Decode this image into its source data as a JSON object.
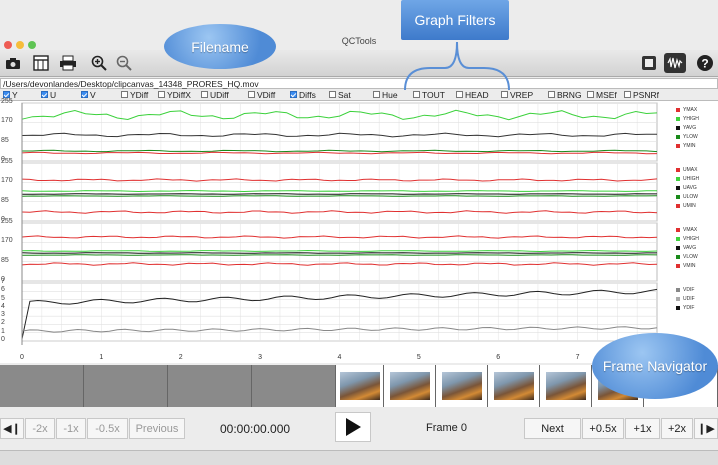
{
  "window": {
    "title": "QCTools"
  },
  "toolbar": {
    "left_icons": [
      "camera-icon",
      "export-icon",
      "print-icon",
      "zoom-in-icon",
      "zoom-out-icon"
    ],
    "right_icons": [
      "windows-icon",
      "waveform-icon",
      "help-icon"
    ]
  },
  "file": {
    "path": "/Users/devonlandes/Desktop/clipcanvas_14348_PRORES_HQ.mov"
  },
  "filters": [
    {
      "label": "Y",
      "checked": true
    },
    {
      "label": "U",
      "checked": true
    },
    {
      "label": "V",
      "checked": true
    },
    {
      "label": "YDiff",
      "checked": false
    },
    {
      "label": "YDiffX",
      "checked": false
    },
    {
      "label": "UDiff",
      "checked": false
    },
    {
      "label": "VDiff",
      "checked": false
    },
    {
      "label": "Diffs",
      "checked": true
    },
    {
      "label": "Sat",
      "checked": false
    },
    {
      "label": "Hue",
      "checked": false
    },
    {
      "label": "TOUT",
      "checked": false
    },
    {
      "label": "HEAD",
      "checked": false
    },
    {
      "label": "VREP",
      "checked": false
    },
    {
      "label": "BRNG",
      "checked": false
    },
    {
      "label": "MSEf",
      "checked": false
    },
    {
      "label": "PSNRf",
      "checked": false
    }
  ],
  "plots": [
    {
      "yticks": [
        "255",
        "170",
        "85",
        "0"
      ],
      "legend": [
        {
          "name": "YMAX",
          "color": "#e03030"
        },
        {
          "name": "YHIGH",
          "color": "#3bd13b"
        },
        {
          "name": "YAVG",
          "color": "#111111"
        },
        {
          "name": "YLOW",
          "color": "#1a8a1a"
        },
        {
          "name": "YMIN",
          "color": "#e03030"
        }
      ]
    },
    {
      "yticks": [
        "255",
        "170",
        "85",
        "0"
      ],
      "legend": [
        {
          "name": "UMAX",
          "color": "#e03030"
        },
        {
          "name": "UHIGH",
          "color": "#3bd13b"
        },
        {
          "name": "UAVG",
          "color": "#111111"
        },
        {
          "name": "ULOW",
          "color": "#1a8a1a"
        },
        {
          "name": "UMIN",
          "color": "#e03030"
        }
      ]
    },
    {
      "yticks": [
        "255",
        "170",
        "85",
        "0"
      ],
      "legend": [
        {
          "name": "VMAX",
          "color": "#e03030"
        },
        {
          "name": "VHIGH",
          "color": "#3bd13b"
        },
        {
          "name": "VAVG",
          "color": "#111111"
        },
        {
          "name": "VLOW",
          "color": "#1a8a1a"
        },
        {
          "name": "VMIN",
          "color": "#e03030"
        }
      ]
    },
    {
      "yticks": [
        "7",
        "6",
        "5",
        "4",
        "3",
        "2",
        "1",
        "0"
      ],
      "legend": [
        {
          "name": "VDIF",
          "color": "#888888"
        },
        {
          "name": "UDIF",
          "color": "#aaaaaa"
        },
        {
          "name": "YDIF",
          "color": "#111111"
        }
      ]
    }
  ],
  "xticks": [
    "0",
    "1",
    "2",
    "3",
    "4",
    "5",
    "6",
    "7"
  ],
  "navigator": {
    "back_label": "◀❙",
    "minus2": "-2x",
    "minus1": "-1x",
    "minus05": "-0.5x",
    "previous": "Previous",
    "timecode": "00:00:00.000",
    "frame": "Frame 0",
    "next": "Next",
    "plus05": "+0.5x",
    "plus1": "+1x",
    "plus2": "+2x",
    "forward_label": "❙▶"
  },
  "annotations": {
    "filename": "Filename",
    "graph_filters": "Graph Filters",
    "frame_navigator": "Frame Navigator"
  },
  "colors": {
    "accent": "#3b8cf0",
    "callout": "#4f8bd6"
  }
}
